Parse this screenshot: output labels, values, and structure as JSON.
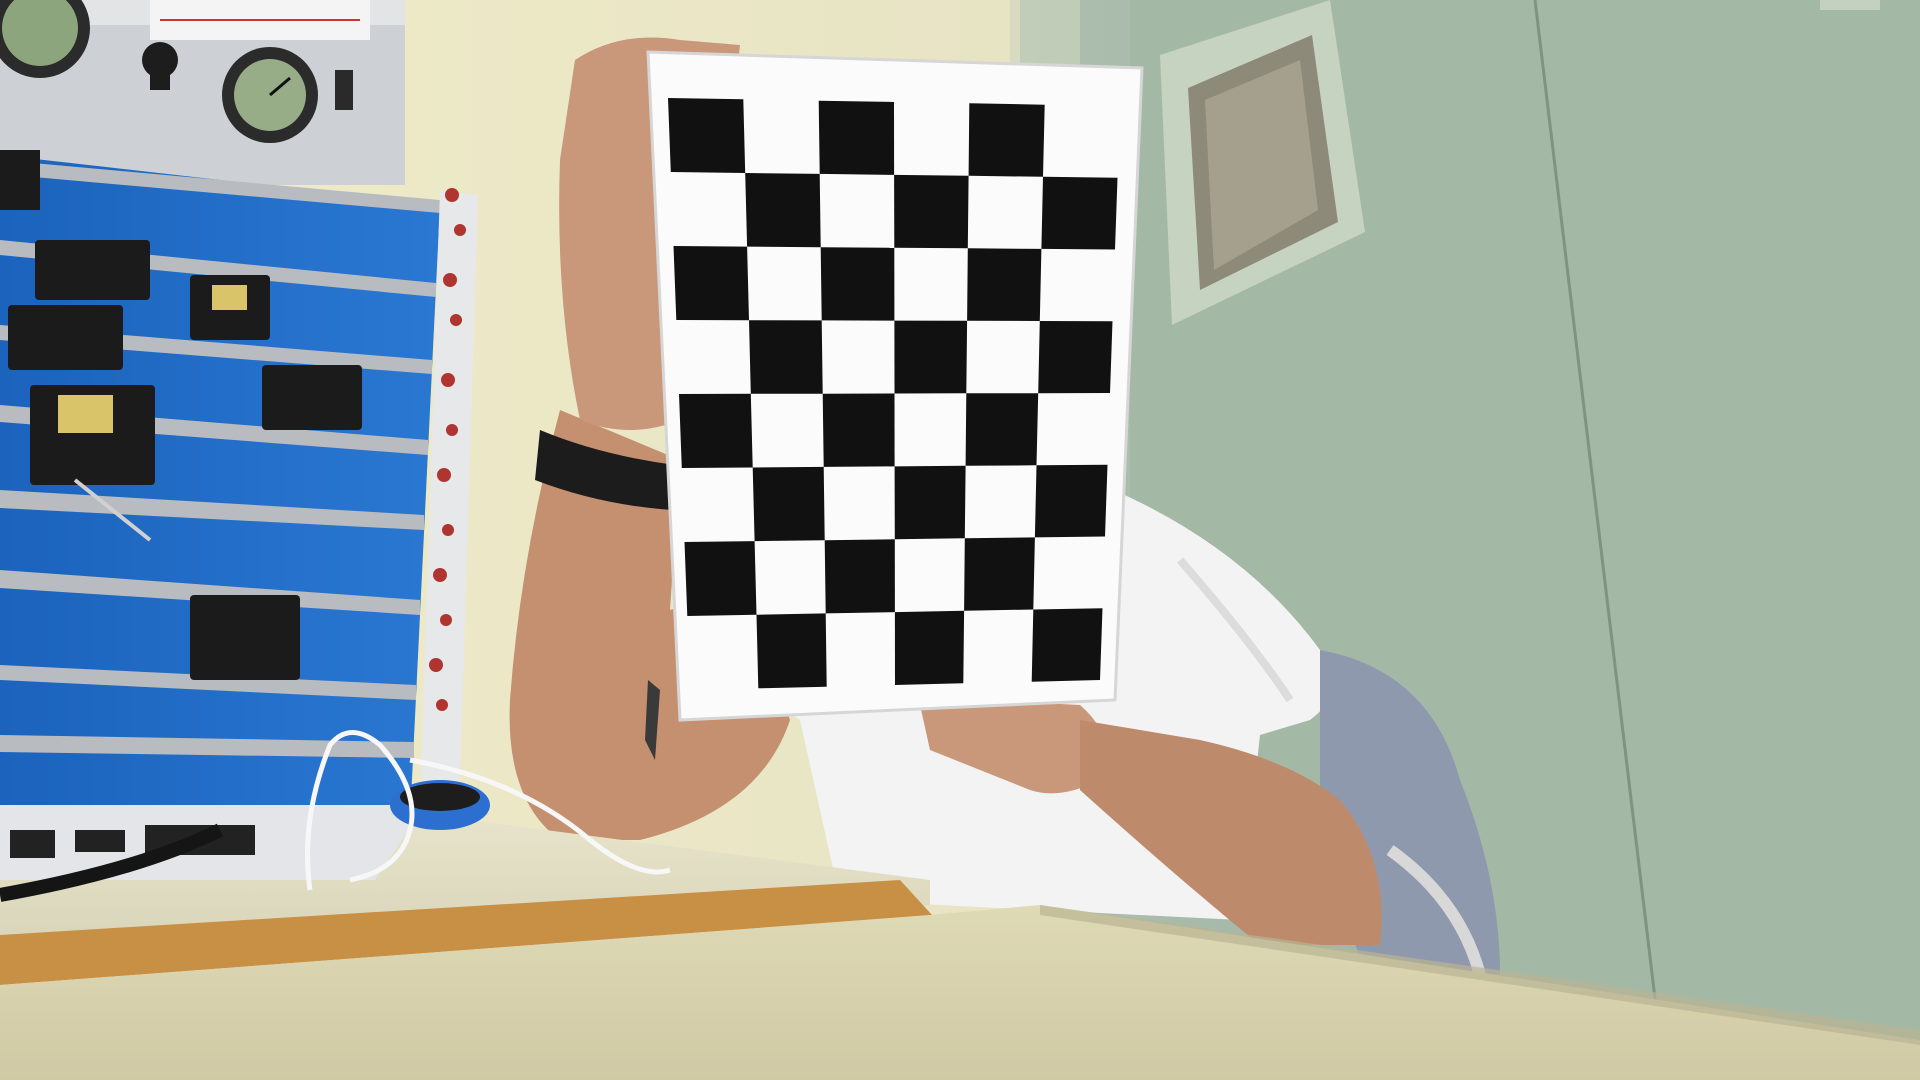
{
  "scene": {
    "colors": {
      "wall_left": "#ebe8c6",
      "wall_right": "#9fb3a3",
      "door": "#a9bcaa",
      "board_panel": "#1e6cc6",
      "rail": "#b9bdc2",
      "checker_dark": "#111111",
      "checker_light": "#fbfbfb",
      "shirt": "#f2f2f2",
      "skin": "#c79377",
      "desk_near": "#d9d4ad",
      "desk_edge": "#c28a3c",
      "laptop": "#e3e4e6"
    },
    "checkerboard": {
      "rows": 8,
      "cols": 6
    }
  }
}
